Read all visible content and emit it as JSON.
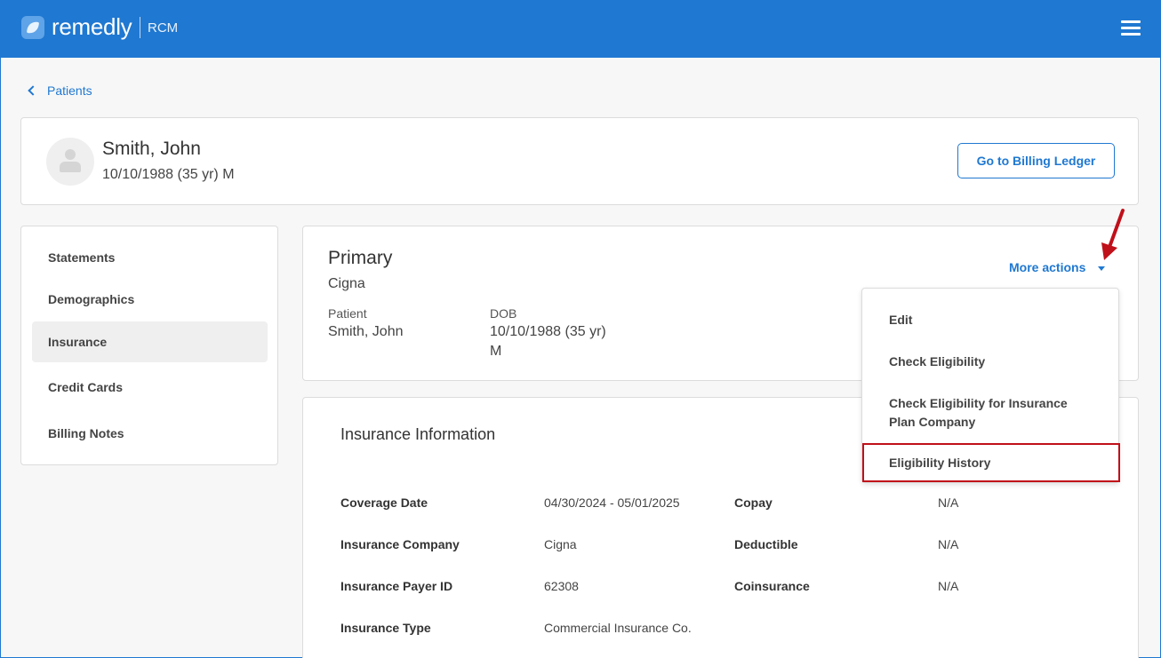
{
  "app": {
    "brand": "remedly",
    "sub": "RCM"
  },
  "breadcrumb": {
    "label": "Patients"
  },
  "patient": {
    "name": "Smith, John",
    "dob_line": "10/10/1988 (35 yr) M",
    "ledger_button": "Go to Billing Ledger"
  },
  "sidebar": {
    "items": [
      {
        "label": "Statements"
      },
      {
        "label": "Demographics"
      },
      {
        "label": "Insurance",
        "active": true
      },
      {
        "label": "Credit Cards"
      },
      {
        "label": "Billing Notes"
      }
    ]
  },
  "primary": {
    "title": "Primary",
    "company": "Cigna",
    "patient_label": "Patient",
    "patient_value": "Smith, John",
    "dob_label": "DOB",
    "dob_value": "10/10/1988 (35 yr)",
    "sex_value": "M",
    "more_actions": "More actions"
  },
  "dropdown": {
    "items": [
      {
        "label": "Edit"
      },
      {
        "label": "Check Eligibility"
      },
      {
        "label": "Check Eligibility for Insurance Plan Company"
      },
      {
        "label": "Eligibility History",
        "highlighted": true
      }
    ]
  },
  "insurance_info": {
    "title": "Insurance Information",
    "left": [
      {
        "label": "Coverage Date",
        "value": "04/30/2024 - 05/01/2025"
      },
      {
        "label": "Insurance Company",
        "value": "Cigna"
      },
      {
        "label": "Insurance Payer ID",
        "value": "62308"
      },
      {
        "label": "Insurance Type",
        "value": "Commercial Insurance Co."
      }
    ],
    "right": [
      {
        "label": "Copay",
        "value": "N/A"
      },
      {
        "label": "Deductible",
        "value": "N/A"
      },
      {
        "label": "Coinsurance",
        "value": "N/A"
      }
    ]
  },
  "colors": {
    "brand_blue": "#1f78d1",
    "highlight_red": "#c0101a"
  }
}
